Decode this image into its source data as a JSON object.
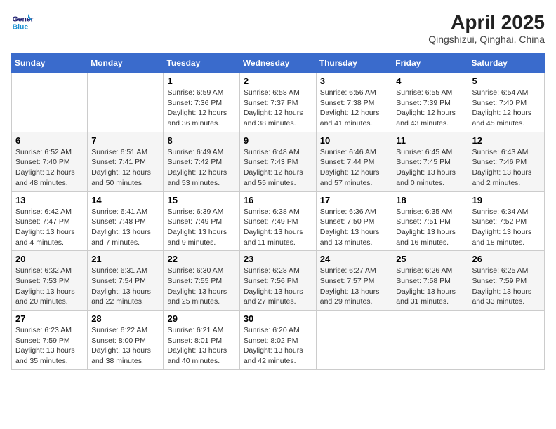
{
  "header": {
    "logo_line1": "General",
    "logo_line2": "Blue",
    "month_year": "April 2025",
    "location": "Qingshizui, Qinghai, China"
  },
  "days_of_week": [
    "Sunday",
    "Monday",
    "Tuesday",
    "Wednesday",
    "Thursday",
    "Friday",
    "Saturday"
  ],
  "weeks": [
    [
      {
        "day": "",
        "info": ""
      },
      {
        "day": "",
        "info": ""
      },
      {
        "day": "1",
        "info": "Sunrise: 6:59 AM\nSunset: 7:36 PM\nDaylight: 12 hours and 36 minutes."
      },
      {
        "day": "2",
        "info": "Sunrise: 6:58 AM\nSunset: 7:37 PM\nDaylight: 12 hours and 38 minutes."
      },
      {
        "day": "3",
        "info": "Sunrise: 6:56 AM\nSunset: 7:38 PM\nDaylight: 12 hours and 41 minutes."
      },
      {
        "day": "4",
        "info": "Sunrise: 6:55 AM\nSunset: 7:39 PM\nDaylight: 12 hours and 43 minutes."
      },
      {
        "day": "5",
        "info": "Sunrise: 6:54 AM\nSunset: 7:40 PM\nDaylight: 12 hours and 45 minutes."
      }
    ],
    [
      {
        "day": "6",
        "info": "Sunrise: 6:52 AM\nSunset: 7:40 PM\nDaylight: 12 hours and 48 minutes."
      },
      {
        "day": "7",
        "info": "Sunrise: 6:51 AM\nSunset: 7:41 PM\nDaylight: 12 hours and 50 minutes."
      },
      {
        "day": "8",
        "info": "Sunrise: 6:49 AM\nSunset: 7:42 PM\nDaylight: 12 hours and 53 minutes."
      },
      {
        "day": "9",
        "info": "Sunrise: 6:48 AM\nSunset: 7:43 PM\nDaylight: 12 hours and 55 minutes."
      },
      {
        "day": "10",
        "info": "Sunrise: 6:46 AM\nSunset: 7:44 PM\nDaylight: 12 hours and 57 minutes."
      },
      {
        "day": "11",
        "info": "Sunrise: 6:45 AM\nSunset: 7:45 PM\nDaylight: 13 hours and 0 minutes."
      },
      {
        "day": "12",
        "info": "Sunrise: 6:43 AM\nSunset: 7:46 PM\nDaylight: 13 hours and 2 minutes."
      }
    ],
    [
      {
        "day": "13",
        "info": "Sunrise: 6:42 AM\nSunset: 7:47 PM\nDaylight: 13 hours and 4 minutes."
      },
      {
        "day": "14",
        "info": "Sunrise: 6:41 AM\nSunset: 7:48 PM\nDaylight: 13 hours and 7 minutes."
      },
      {
        "day": "15",
        "info": "Sunrise: 6:39 AM\nSunset: 7:49 PM\nDaylight: 13 hours and 9 minutes."
      },
      {
        "day": "16",
        "info": "Sunrise: 6:38 AM\nSunset: 7:49 PM\nDaylight: 13 hours and 11 minutes."
      },
      {
        "day": "17",
        "info": "Sunrise: 6:36 AM\nSunset: 7:50 PM\nDaylight: 13 hours and 13 minutes."
      },
      {
        "day": "18",
        "info": "Sunrise: 6:35 AM\nSunset: 7:51 PM\nDaylight: 13 hours and 16 minutes."
      },
      {
        "day": "19",
        "info": "Sunrise: 6:34 AM\nSunset: 7:52 PM\nDaylight: 13 hours and 18 minutes."
      }
    ],
    [
      {
        "day": "20",
        "info": "Sunrise: 6:32 AM\nSunset: 7:53 PM\nDaylight: 13 hours and 20 minutes."
      },
      {
        "day": "21",
        "info": "Sunrise: 6:31 AM\nSunset: 7:54 PM\nDaylight: 13 hours and 22 minutes."
      },
      {
        "day": "22",
        "info": "Sunrise: 6:30 AM\nSunset: 7:55 PM\nDaylight: 13 hours and 25 minutes."
      },
      {
        "day": "23",
        "info": "Sunrise: 6:28 AM\nSunset: 7:56 PM\nDaylight: 13 hours and 27 minutes."
      },
      {
        "day": "24",
        "info": "Sunrise: 6:27 AM\nSunset: 7:57 PM\nDaylight: 13 hours and 29 minutes."
      },
      {
        "day": "25",
        "info": "Sunrise: 6:26 AM\nSunset: 7:58 PM\nDaylight: 13 hours and 31 minutes."
      },
      {
        "day": "26",
        "info": "Sunrise: 6:25 AM\nSunset: 7:59 PM\nDaylight: 13 hours and 33 minutes."
      }
    ],
    [
      {
        "day": "27",
        "info": "Sunrise: 6:23 AM\nSunset: 7:59 PM\nDaylight: 13 hours and 35 minutes."
      },
      {
        "day": "28",
        "info": "Sunrise: 6:22 AM\nSunset: 8:00 PM\nDaylight: 13 hours and 38 minutes."
      },
      {
        "day": "29",
        "info": "Sunrise: 6:21 AM\nSunset: 8:01 PM\nDaylight: 13 hours and 40 minutes."
      },
      {
        "day": "30",
        "info": "Sunrise: 6:20 AM\nSunset: 8:02 PM\nDaylight: 13 hours and 42 minutes."
      },
      {
        "day": "",
        "info": ""
      },
      {
        "day": "",
        "info": ""
      },
      {
        "day": "",
        "info": ""
      }
    ]
  ]
}
